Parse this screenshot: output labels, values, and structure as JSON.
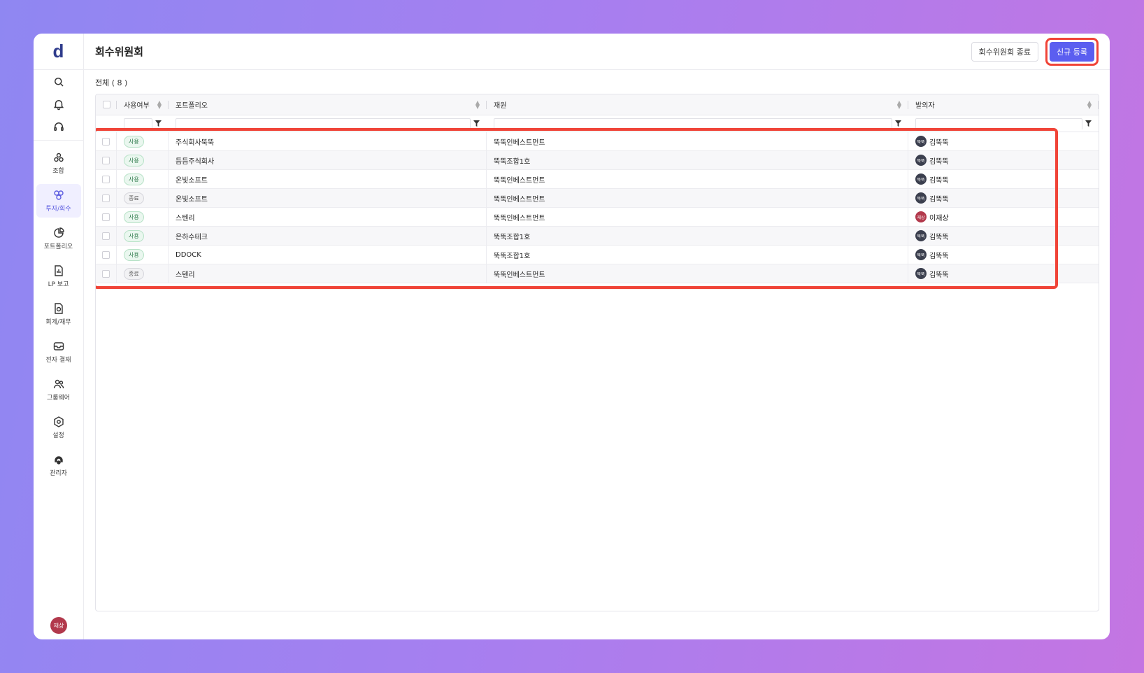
{
  "app": {
    "logo": "d",
    "user_avatar": "재상"
  },
  "sidebar": {
    "top_icons": [
      "search-icon",
      "bell-icon",
      "headset-icon"
    ],
    "items": [
      {
        "label": "조합",
        "icon": "cluster-icon",
        "active": false
      },
      {
        "label": "투자/회수",
        "icon": "invest-icon",
        "active": true
      },
      {
        "label": "포트폴리오",
        "icon": "pie-icon",
        "active": false
      },
      {
        "label": "LP 보고",
        "icon": "report-icon",
        "active": false
      },
      {
        "label": "회계/재무",
        "icon": "finance-icon",
        "active": false
      },
      {
        "label": "전자 결재",
        "icon": "approval-icon",
        "active": false
      },
      {
        "label": "그룹웨어",
        "icon": "group-icon",
        "active": false
      },
      {
        "label": "설정",
        "icon": "gear-icon",
        "active": false
      },
      {
        "label": "관리자",
        "icon": "admin-icon",
        "active": false
      }
    ]
  },
  "header": {
    "title": "회수위원회",
    "end_button": "회수위원회 종료",
    "new_button": "신규 등록"
  },
  "table": {
    "count_label": "전체 ( 8 )",
    "columns": [
      "사용여부",
      "포트폴리오",
      "재원",
      "발의자"
    ],
    "rows": [
      {
        "status": "사용",
        "active": true,
        "portfolio": "주식회사뚝뚝",
        "fund": "뚝뚝인베스트먼트",
        "avatar": "뚝뚝",
        "proposer": "김뚝뚝",
        "avatar_color": "dark"
      },
      {
        "status": "사용",
        "active": true,
        "portfolio": "듬듬주식회사",
        "fund": "뚝뚝조합1호",
        "avatar": "뚝뚝",
        "proposer": "김뚝뚝",
        "avatar_color": "dark"
      },
      {
        "status": "사용",
        "active": true,
        "portfolio": "온빛소프트",
        "fund": "뚝뚝인베스트먼트",
        "avatar": "뚝뚝",
        "proposer": "김뚝뚝",
        "avatar_color": "dark"
      },
      {
        "status": "종료",
        "active": false,
        "portfolio": "온빛소프트",
        "fund": "뚝뚝인베스트먼트",
        "avatar": "뚝뚝",
        "proposer": "김뚝뚝",
        "avatar_color": "dark"
      },
      {
        "status": "사용",
        "active": true,
        "portfolio": "스텐리",
        "fund": "뚝뚝인베스트먼트",
        "avatar": "재상",
        "proposer": "이재상",
        "avatar_color": "red"
      },
      {
        "status": "사용",
        "active": true,
        "portfolio": "은하수테크",
        "fund": "뚝뚝조합1호",
        "avatar": "뚝뚝",
        "proposer": "김뚝뚝",
        "avatar_color": "dark"
      },
      {
        "status": "사용",
        "active": true,
        "portfolio": "DDOCK",
        "fund": "뚝뚝조합1호",
        "avatar": "뚝뚝",
        "proposer": "김뚝뚝",
        "avatar_color": "dark"
      },
      {
        "status": "종료",
        "active": false,
        "portfolio": "스텐리",
        "fund": "뚝뚝인베스트먼트",
        "avatar": "뚝뚝",
        "proposer": "김뚝뚝",
        "avatar_color": "dark"
      }
    ]
  },
  "colors": {
    "accent": "#5b5ef0",
    "highlight": "#f04438",
    "active_badge": "#eaf7ef",
    "avatar_red": "#b2394c"
  }
}
